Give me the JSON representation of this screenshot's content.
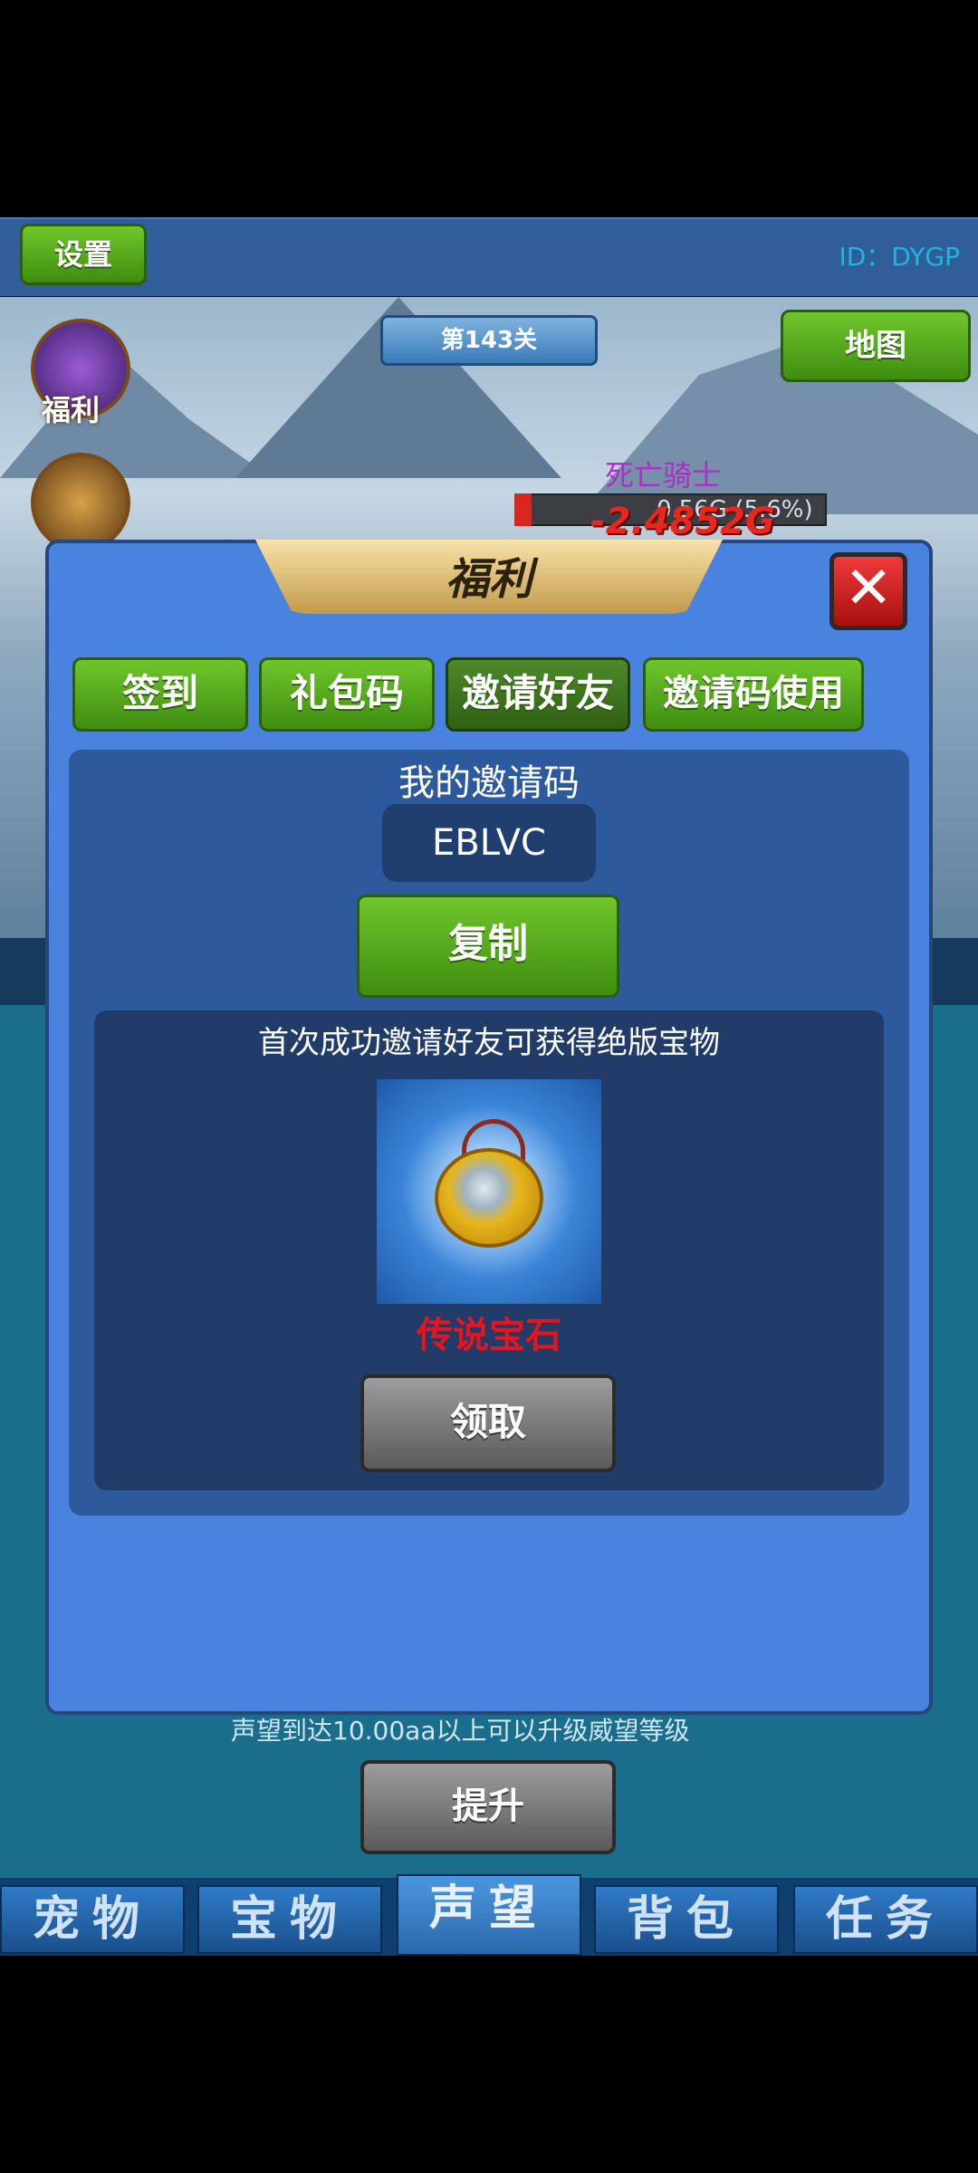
{
  "header": {
    "settings_label": "设置",
    "user_id": "ID：DYGP"
  },
  "scene": {
    "level": "第143关",
    "map_label": "地图",
    "welfare_label": "福利",
    "boss_name": "死亡骑士",
    "boss_hp_text": "0.56G (5.6%)",
    "boss_hp_fraction": 0.056,
    "damage_text": "-2.4852G"
  },
  "modal": {
    "title": "福利",
    "close_label": "✕",
    "tabs": [
      "签到",
      "礼包码",
      "邀请好友",
      "邀请码使用"
    ],
    "active_tab": "邀请好友",
    "code_title": "我的邀请码",
    "code_value": "EBLVC",
    "copy_label": "复制",
    "reward_desc": "首次成功邀请好友可获得绝版宝物",
    "reward_name": "传说宝石",
    "claim_label": "领取"
  },
  "lower": {
    "prestige_note": "声望到达10.00aa以上可以升级威望等级",
    "upgrade_label": "提升"
  },
  "bottom_tabs": [
    "宠物",
    "宝物",
    "声望",
    "背包",
    "任务"
  ],
  "bottom_active": "声望"
}
